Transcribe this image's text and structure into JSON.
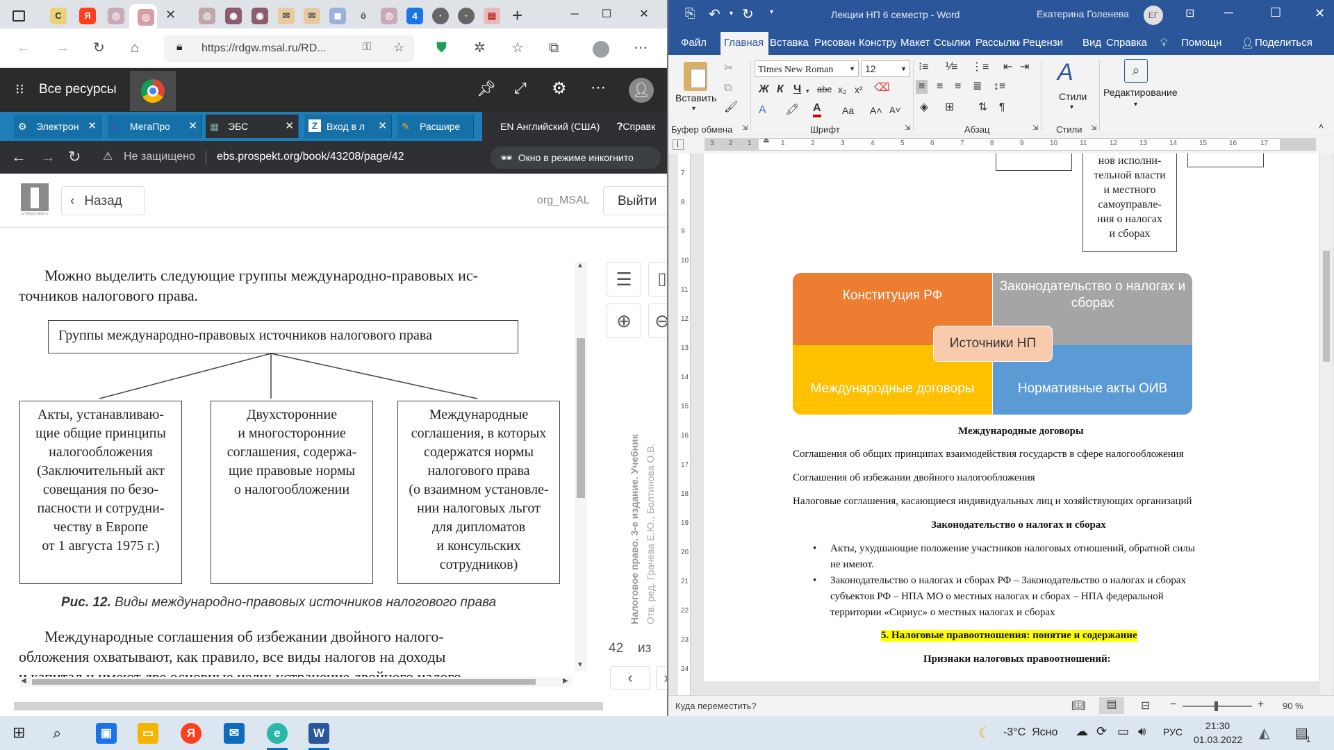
{
  "edge": {
    "tab_count": "4",
    "address": "https://rdgw.msal.ru/RD...",
    "colors": {
      "tabbar": "#dfe2e7",
      "app_header": "#2b2b2b",
      "chrome_tabs": "#1e7fb8"
    }
  },
  "app_header": {
    "title": "Все ресурсы"
  },
  "chrome": {
    "tabs": [
      {
        "label": "Электрон"
      },
      {
        "label": "МегаПро"
      },
      {
        "label": "ЭБС"
      },
      {
        "label": "Вход в л"
      },
      {
        "label": "Расшире"
      }
    ],
    "language": "EN Английский (США)",
    "help": "Справк",
    "security": "Не защищено",
    "url": "ebs.prospekt.org/book/43208/page/42",
    "incognito": "Окно в режиме инкогнито"
  },
  "reader": {
    "logo_text": "«ПРОСПЕКТ»",
    "back": "Назад",
    "user": "org_MSAL",
    "logout": "Выйти",
    "page_current": "42",
    "page_of": "из",
    "side_title": "Налоговое право. 3-е издание. Учебник",
    "side_authors": "Отв. ред. Грачева Е.Ю., Болтинова О.В."
  },
  "book": {
    "intro_line1": "Можно выделить следующие группы международно-правовых ис-",
    "intro_line2": "точников налогового права.",
    "diagram_title": "Группы международно-правовых источников налогового права",
    "boxes": [
      {
        "lines": [
          "Акты, устанавливаю-",
          "щие общие принципы",
          "налогообложения",
          "(Заключительный акт",
          "совещания по безо-",
          "пасности и сотрудни-",
          "честву в Европе",
          "от 1 августа 1975 г.)"
        ]
      },
      {
        "lines": [
          "Двухсторонние",
          "и многосторонние",
          "соглашения, содержа-",
          "щие правовые нормы",
          "о налогообложении"
        ]
      },
      {
        "lines": [
          "Международные",
          "соглашения, в которых",
          "содержатся нормы",
          "налогового права",
          "(о взаимном установле-",
          "нии налоговых льгот",
          "для дипломатов",
          "и консульских",
          "сотрудников)"
        ]
      }
    ],
    "caption_num": "Рис. 12.",
    "caption_text": "Виды международно-правовых источников налогового права",
    "para_line1": "Международные соглашения об избежании двойного налого-",
    "para_line2": "обложения охватывают, как правило, все виды налогов на доходы",
    "para_line3": "и капитал и имеют две основные цели: устранение двойного налого-"
  },
  "word": {
    "title": "Лекции НП 6 семестр - Word",
    "user": "Екатерина Голенева",
    "initials": "ЕГ",
    "menu": [
      "Файл",
      "Главная",
      "Вставка",
      "Рисован",
      "Конструктор",
      "Макет",
      "Ссылки",
      "Рассылки",
      "Рецензи",
      "Вид",
      "Справка"
    ],
    "help_search": "Помощн",
    "share": "Поделиться",
    "paste": "Вставить",
    "font_name": "Times New Roman",
    "font_size": "12",
    "bold": "Ж",
    "italic": "К",
    "underline": "Ч",
    "styles": "Стили",
    "editing": "Редактирование",
    "groups": {
      "clipboard": "Буфер обмена",
      "font": "Шрифт",
      "paragraph": "Абзац",
      "styles": "Стили"
    },
    "ruler_numbers": [
      "3",
      "2",
      "1",
      "1",
      "2",
      "3",
      "4",
      "5",
      "6",
      "7",
      "8",
      "9",
      "10",
      "11",
      "12",
      "13",
      "14",
      "15",
      "16",
      "17"
    ],
    "vruler_numbers": [
      "7",
      "8",
      "9",
      "10",
      "11",
      "12",
      "13",
      "14",
      "15",
      "16",
      "17",
      "18",
      "19",
      "20",
      "21",
      "22",
      "23",
      "24"
    ],
    "top_box_lines": [
      "нов исполни-",
      "тельной власти",
      "и местного",
      "самоуправле-",
      "ния о налогах",
      "и сборах"
    ],
    "smartart": {
      "q1": "Конституция РФ",
      "q2_line1": "Законодательство о налогах и",
      "q2_line2": "сборах",
      "q3": "Международные договоры",
      "q4": "Нормативные акты ОИВ",
      "center": "Источники НП",
      "colors": {
        "q1": "#ed7d31",
        "q2": "#a5a5a5",
        "q3": "#ffc000",
        "q4": "#5b9bd5",
        "center": "#f8cbad"
      }
    },
    "doc": {
      "h1": "Международные договоры",
      "p1": "Соглашения об общих принципах взаимодействия государств в сфере налогообложения",
      "p2": "Соглашения об избежании двойного налогообложения",
      "p3": "Налоговые соглашения, касающиеся индивидуальных лиц и хозяйствующих организаций",
      "h2": "Законодательство о налогах и сборах",
      "b1_l1": "Акты, ухудшающие положение участников налоговых отношений, обратной силы",
      "b1_l2": "не имеют.",
      "b2_l1": "Законодательство о налогах и сборах РФ – Законодательство о налогах и сборах",
      "b2_l2": "субъектов РФ – НПА МО о местных налогах и сборах – НПА федеральной",
      "b2_l3": "территории «Сириус» о местных налогах и сборах",
      "h3": "5. Налоговые правоотношения: понятие и содержание",
      "h4": "Признаки налоговых правоотношений:"
    },
    "status_left": "Куда переместить?",
    "zoom": "90 %"
  },
  "taskbar": {
    "weather": "-3°C  Ясно",
    "lang": "РУС",
    "time": "21:30",
    "date": "01.03.2022",
    "notif_count": "1"
  }
}
